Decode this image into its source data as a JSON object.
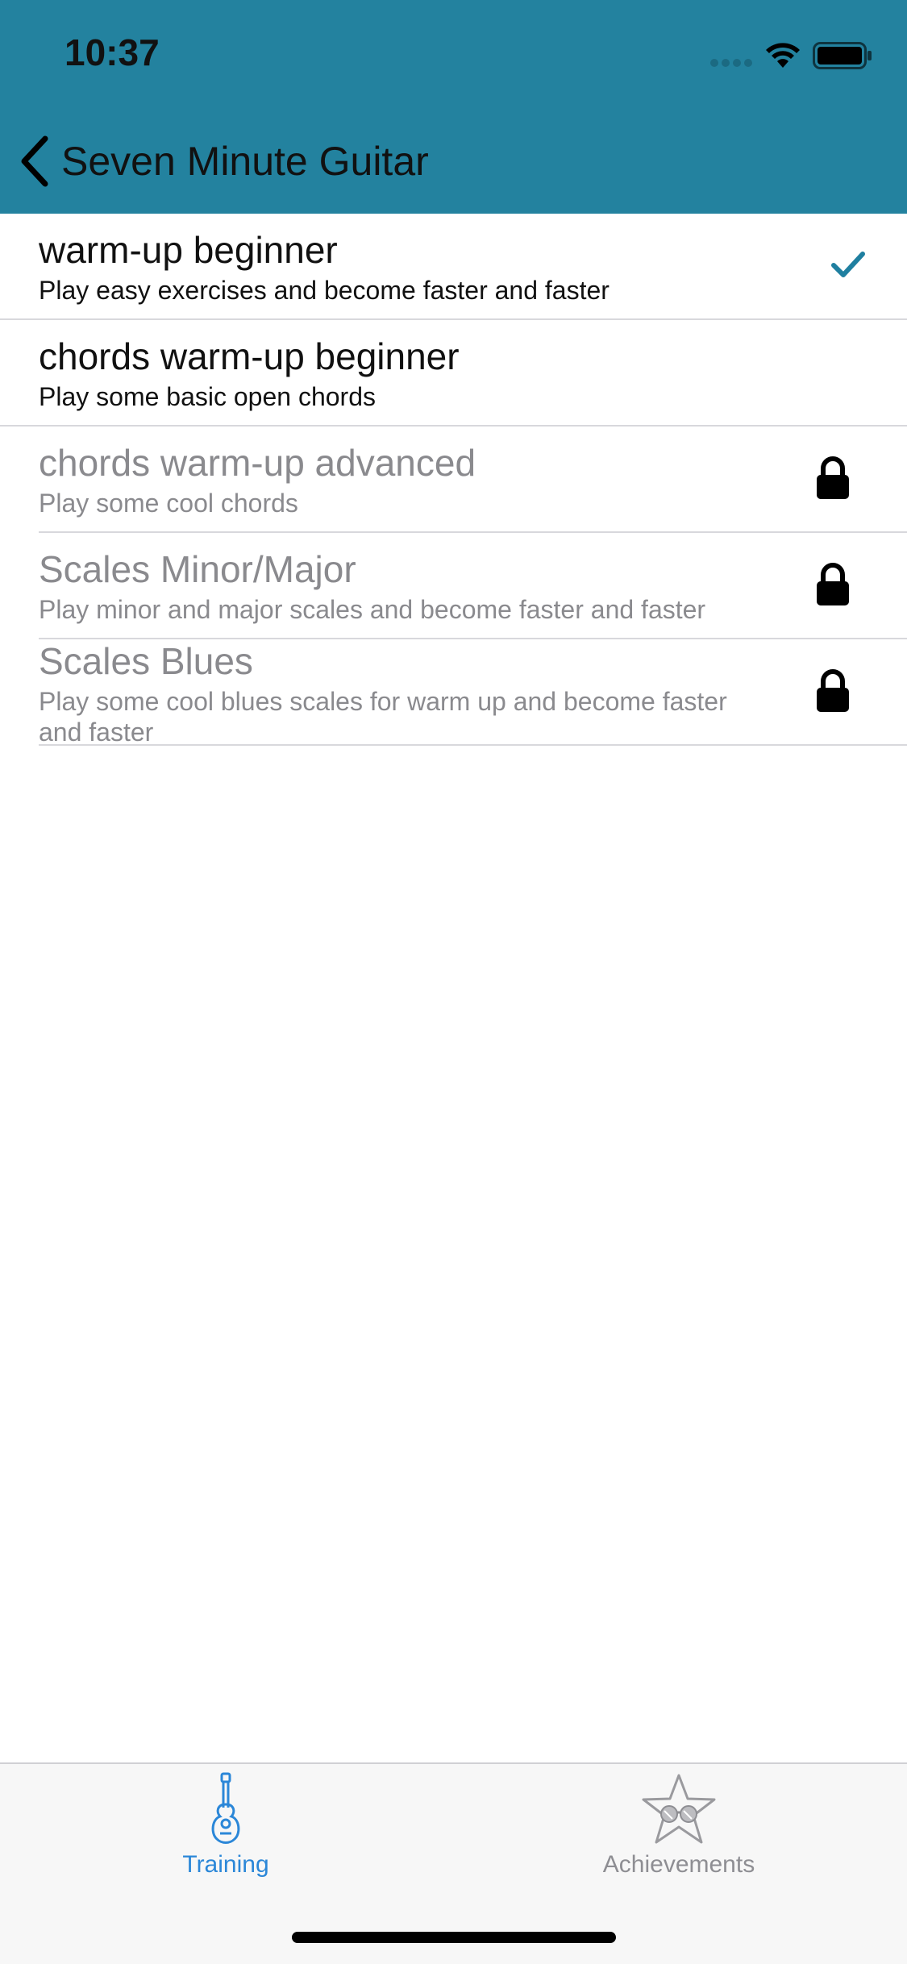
{
  "status_bar": {
    "time": "10:37"
  },
  "nav": {
    "back_label": "Seven Minute Guitar"
  },
  "colors": {
    "header": "#23829f",
    "accent": "#1f7fa0",
    "tab_active": "#2b87d8"
  },
  "list": {
    "items": [
      {
        "title": "warm-up beginner",
        "subtitle": "Play easy exercises and become faster and faster",
        "state": "completed",
        "icon": "checkmark-icon"
      },
      {
        "title": "chords warm-up beginner",
        "subtitle": "Play some basic open chords",
        "state": "unlocked",
        "icon": ""
      },
      {
        "title": "chords warm-up advanced",
        "subtitle": "Play some cool chords",
        "state": "locked",
        "icon": "lock-icon"
      },
      {
        "title": "Scales Minor/Major",
        "subtitle": "Play minor and major scales and become faster and faster",
        "state": "locked",
        "icon": "lock-icon"
      },
      {
        "title": "Scales Blues",
        "subtitle": "Play some cool blues scales for warm up and become faster and faster",
        "state": "locked",
        "icon": "lock-icon"
      }
    ]
  },
  "tabbar": {
    "tabs": [
      {
        "label": "Training",
        "icon": "guitar-icon",
        "selected": true
      },
      {
        "label": "Achievements",
        "icon": "star-sunglasses-icon",
        "selected": false
      }
    ]
  }
}
